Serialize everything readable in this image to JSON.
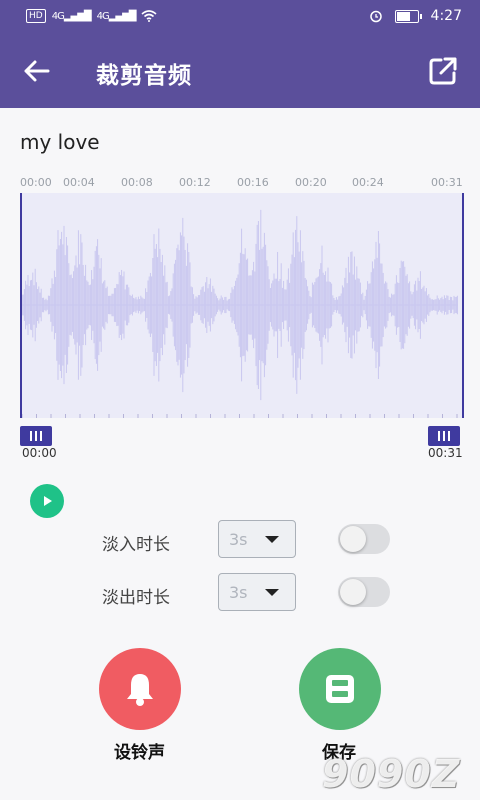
{
  "status_bar": {
    "hd": "HD",
    "network1": "4G",
    "network2": "4G",
    "time": "4:27"
  },
  "toolbar": {
    "title": "裁剪音频"
  },
  "file": {
    "name": "my love"
  },
  "timeline": {
    "ticks": [
      "00:00",
      "00:04",
      "00:08",
      "00:12",
      "00:16",
      "00:20",
      "00:24",
      "00:31"
    ],
    "start_time": "00:00",
    "end_time": "00:31"
  },
  "fade_in": {
    "label": "淡入时长",
    "value": "3s",
    "enabled": false
  },
  "fade_out": {
    "label": "淡出时长",
    "value": "3s",
    "enabled": false
  },
  "actions": {
    "ringtone_label": "设铃声",
    "save_label": "保存"
  },
  "watermark": "9090Z",
  "colors": {
    "primary": "#5b4f9b",
    "selection": "#3f3a9f",
    "waveform": "#c9c7ef",
    "play": "#1fc288",
    "ringtone": "#f05c62",
    "save": "#55b876"
  }
}
